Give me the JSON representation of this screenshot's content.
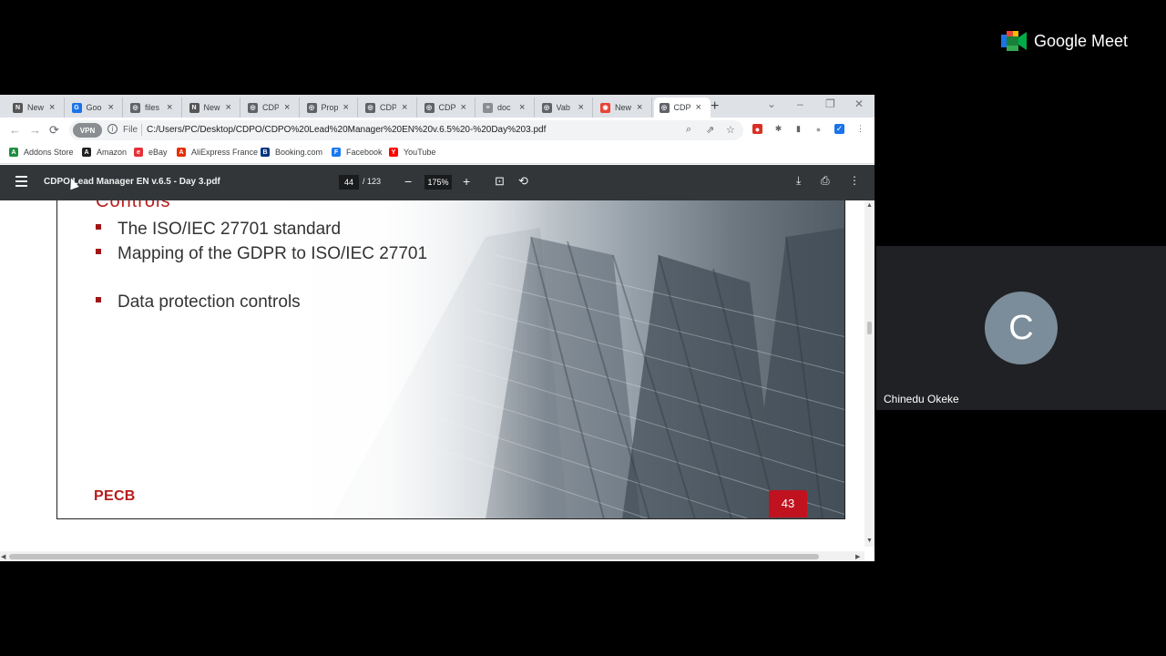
{
  "browser": {
    "tabs": [
      {
        "label": "New",
        "icon": "notion-icon",
        "color": "#555555",
        "glyph": "N"
      },
      {
        "label": "Goo",
        "icon": "google-drive-icon",
        "color": "#1a73e8",
        "glyph": "G"
      },
      {
        "label": "files",
        "icon": "globe-icon",
        "color": "#5f6368",
        "glyph": "◎"
      },
      {
        "label": "New",
        "icon": "notion-icon",
        "color": "#555555",
        "glyph": "N"
      },
      {
        "label": "CDP",
        "icon": "globe-icon",
        "color": "#5f6368",
        "glyph": "◎"
      },
      {
        "label": "Prop",
        "icon": "globe-icon",
        "color": "#5f6368",
        "glyph": "◎"
      },
      {
        "label": "CDP",
        "icon": "globe-icon",
        "color": "#5f6368",
        "glyph": "◎"
      },
      {
        "label": "CDP",
        "icon": "globe-icon",
        "color": "#5f6368",
        "glyph": "◎"
      },
      {
        "label": "doc",
        "icon": "document-icon",
        "color": "#8a8d91",
        "glyph": "≡"
      },
      {
        "label": "Vab",
        "icon": "globe-icon",
        "color": "#5f6368",
        "glyph": "◎"
      },
      {
        "label": "New",
        "icon": "chrome-icon",
        "color": "#ea4335",
        "glyph": "◉"
      },
      {
        "label": "CDP",
        "icon": "globe-icon",
        "color": "#5f6368",
        "glyph": "◎",
        "active": true
      }
    ],
    "omnibox": {
      "vpn_label": "VPN",
      "scheme": "File",
      "url": "C:/Users/PC/Desktop/CDPO/CDPO%20Lead%20Manager%20EN%20v.6.5%20-%20Day%203.pdf"
    },
    "bookmarks": [
      {
        "label": "Addons Store",
        "icon": "addons-store-icon",
        "color": "#1e8e3e"
      },
      {
        "label": "Amazon",
        "icon": "amazon-icon",
        "color": "#222222"
      },
      {
        "label": "eBay",
        "icon": "ebay-icon",
        "color": "#e53238"
      },
      {
        "label": "AliExpress France",
        "icon": "aliexpress-icon",
        "color": "#e62e04"
      },
      {
        "label": "Booking.com",
        "icon": "booking-icon",
        "color": "#003580"
      },
      {
        "label": "Facebook",
        "icon": "facebook-icon",
        "color": "#1877f2"
      },
      {
        "label": "YouTube",
        "icon": "youtube-icon",
        "color": "#ff0000"
      }
    ]
  },
  "pdf": {
    "title": "CDPO Lead Manager EN v.6.5 - Day 3.pdf",
    "current_page": "44",
    "page_total": "/ 123",
    "zoom": "175%"
  },
  "slide": {
    "heading_cut": "Controls",
    "bullets": [
      "The ISO/IEC 27701 standard",
      "Mapping of the GDPR to ISO/IEC 27701",
      "Data protection controls"
    ],
    "logo": "PECB",
    "number": "43",
    "accent_color": "#c1121f"
  },
  "meet": {
    "brand": "Google Meet",
    "participant": {
      "initial": "C",
      "name": "Chinedu Okeke"
    }
  }
}
